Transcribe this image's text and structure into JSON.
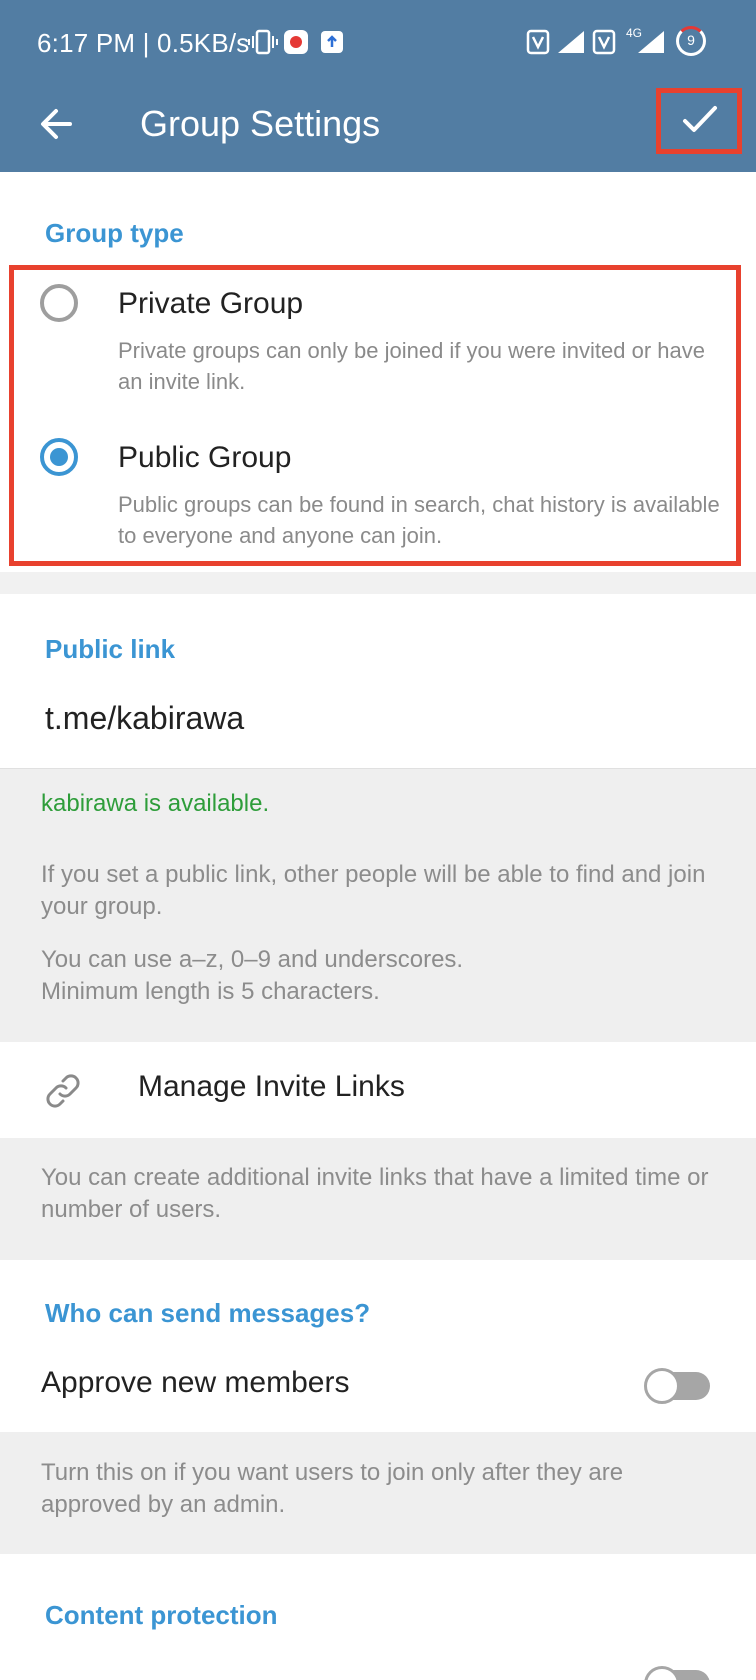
{
  "status_bar": {
    "time_net": "6:17 PM | 0.5KB/s",
    "battery_level": "9",
    "network_label": "4G"
  },
  "appbar": {
    "title": "Group Settings",
    "back_icon": "arrow-left-icon",
    "done_icon": "check-icon"
  },
  "group_type": {
    "section_title": "Group type",
    "options": [
      {
        "label": "Private Group",
        "description": "Private groups can only be joined if you were invited or have an invite link.",
        "selected": false
      },
      {
        "label": "Public Group",
        "description": "Public groups can be found in search, chat history is available to everyone and anyone can join.",
        "selected": true
      }
    ]
  },
  "public_link": {
    "section_title": "Public link",
    "value": "t.me/kabirawa",
    "availability": "kabirawa is available.",
    "info_1": "If you set a public link, other people will be able to find and join your group.",
    "info_2": "You can use a–z, 0–9 and underscores.",
    "info_3": "Minimum length is 5 characters."
  },
  "invite_links": {
    "label": "Manage Invite Links",
    "icon": "link-icon",
    "info": "You can create additional invite links that have a limited time or number of users."
  },
  "send_messages": {
    "section_title": "Who can send messages?",
    "approve_label": "Approve new members",
    "approve_enabled": false,
    "info": "Turn this on if you want users to join only after they are approved by an admin."
  },
  "content_protection": {
    "section_title": "Content protection"
  },
  "colors": {
    "toolbar": "#527da3",
    "accent": "#3b95d3",
    "highlight": "#e8412e",
    "available": "#2e9d3a"
  }
}
